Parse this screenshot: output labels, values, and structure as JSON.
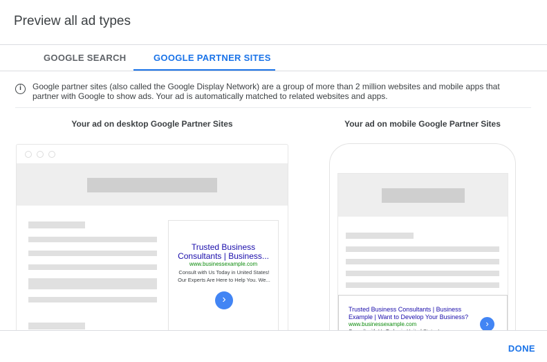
{
  "dialog": {
    "title": "Preview all ad types"
  },
  "tabs": [
    {
      "label": "GOOGLE SEARCH",
      "active": false
    },
    {
      "label": "GOOGLE PARTNER SITES",
      "active": true
    }
  ],
  "info": {
    "icon": "info-icon",
    "text": "Google partner sites (also called the Google Display Network) are a group of more than 2 million websites and mobile apps that partner with Google to show ads. Your ad is automatically matched to related websites and apps."
  },
  "desktop": {
    "heading": "Your ad on desktop Google Partner Sites",
    "ad": {
      "title": "Trusted Business Consultants | Business...",
      "url": "www.businessexample.com",
      "desc_line1": "Consult with Us Today in United States!",
      "desc_line2": "Our Experts Are Here to Help You. We...",
      "button_icon": "chevron-right-icon"
    }
  },
  "mobile": {
    "heading": "Your ad on mobile Google Partner Sites",
    "ad": {
      "title": "Trusted Business Consultants | Business Example | Want to Develop Your Business?",
      "url": "www.businessexample.com",
      "desc": "Consult with Us Today in United States!",
      "button_icon": "chevron-right-icon"
    }
  },
  "footer": {
    "done_label": "DONE"
  },
  "colors": {
    "accent": "#1a73e8",
    "ad_title": "#1a0dab",
    "ad_url": "#0b8a0b",
    "ad_button": "#4285f4"
  }
}
